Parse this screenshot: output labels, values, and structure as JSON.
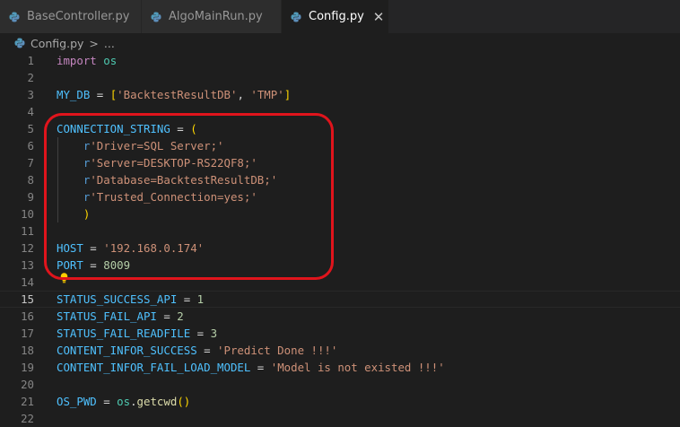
{
  "tabs": [
    {
      "label": "BaseController.py",
      "active": false
    },
    {
      "label": "AlgoMainRun.py",
      "active": false
    },
    {
      "label": "Config.py",
      "active": true
    }
  ],
  "breadcrumb": {
    "file": "Config.py",
    "separator": ">",
    "ellipsis": "..."
  },
  "editor": {
    "current_line": 15,
    "line_numbers": [
      "1",
      "2",
      "3",
      "4",
      "5",
      "6",
      "7",
      "8",
      "9",
      "10",
      "11",
      "12",
      "13",
      "14",
      "15",
      "16",
      "17",
      "18",
      "19",
      "20",
      "21",
      "22"
    ],
    "lines": [
      [
        {
          "t": "import",
          "c": "kw"
        },
        {
          "t": " "
        },
        {
          "t": "os",
          "c": "mod"
        }
      ],
      [],
      [
        {
          "t": "MY_DB",
          "c": "var"
        },
        {
          "t": " = "
        },
        {
          "t": "[",
          "c": "br1"
        },
        {
          "t": "'BacktestResultDB'",
          "c": "str"
        },
        {
          "t": ", "
        },
        {
          "t": "'TMP'",
          "c": "str"
        },
        {
          "t": "]",
          "c": "br1"
        }
      ],
      [],
      [
        {
          "t": "CONNECTION_STRING",
          "c": "var"
        },
        {
          "t": " = "
        },
        {
          "t": "(",
          "c": "br1"
        }
      ],
      [
        {
          "t": "    "
        },
        {
          "t": "r",
          "c": "pfx"
        },
        {
          "t": "'Driver=SQL Server;'",
          "c": "str"
        }
      ],
      [
        {
          "t": "    "
        },
        {
          "t": "r",
          "c": "pfx"
        },
        {
          "t": "'Server=DESKTOP-RS22QF8;'",
          "c": "str"
        }
      ],
      [
        {
          "t": "    "
        },
        {
          "t": "r",
          "c": "pfx"
        },
        {
          "t": "'Database=BacktestResultDB;'",
          "c": "str"
        }
      ],
      [
        {
          "t": "    "
        },
        {
          "t": "r",
          "c": "pfx"
        },
        {
          "t": "'Trusted_Connection=yes;'",
          "c": "str"
        }
      ],
      [
        {
          "t": "    "
        },
        {
          "t": ")",
          "c": "br1"
        }
      ],
      [],
      [
        {
          "t": "HOST",
          "c": "var"
        },
        {
          "t": " = "
        },
        {
          "t": "'192.168.0.174'",
          "c": "str"
        }
      ],
      [
        {
          "t": "PORT",
          "c": "var"
        },
        {
          "t": " = "
        },
        {
          "t": "8009",
          "c": "num"
        }
      ],
      [],
      [
        {
          "t": "STATUS_SUCCESS_API",
          "c": "var"
        },
        {
          "t": " = "
        },
        {
          "t": "1",
          "c": "num"
        }
      ],
      [
        {
          "t": "STATUS_FAIL_API",
          "c": "var"
        },
        {
          "t": " = "
        },
        {
          "t": "2",
          "c": "num"
        }
      ],
      [
        {
          "t": "STATUS_FAIL_READFILE",
          "c": "var"
        },
        {
          "t": " = "
        },
        {
          "t": "3",
          "c": "num"
        }
      ],
      [
        {
          "t": "CONTENT_INFOR_SUCCESS",
          "c": "var"
        },
        {
          "t": " = "
        },
        {
          "t": "'Predict Done !!!'",
          "c": "str"
        }
      ],
      [
        {
          "t": "CONTENT_INFOR_FAIL_LOAD_MODEL",
          "c": "var"
        },
        {
          "t": " = "
        },
        {
          "t": "'Model is not existed !!!'",
          "c": "str"
        }
      ],
      [],
      [
        {
          "t": "OS_PWD",
          "c": "var"
        },
        {
          "t": " = "
        },
        {
          "t": "os",
          "c": "mod"
        },
        {
          "t": "."
        },
        {
          "t": "getcwd",
          "c": "fn"
        },
        {
          "t": "(",
          "c": "br1"
        },
        {
          "t": ")",
          "c": "br1"
        }
      ],
      []
    ]
  },
  "colors": {
    "background": "#1e1e1e",
    "highlight_annotation": "#e0141c",
    "lightbulb": "#ffcc00"
  },
  "icons": [
    "python-file-icon",
    "close-icon",
    "lightbulb-icon"
  ]
}
